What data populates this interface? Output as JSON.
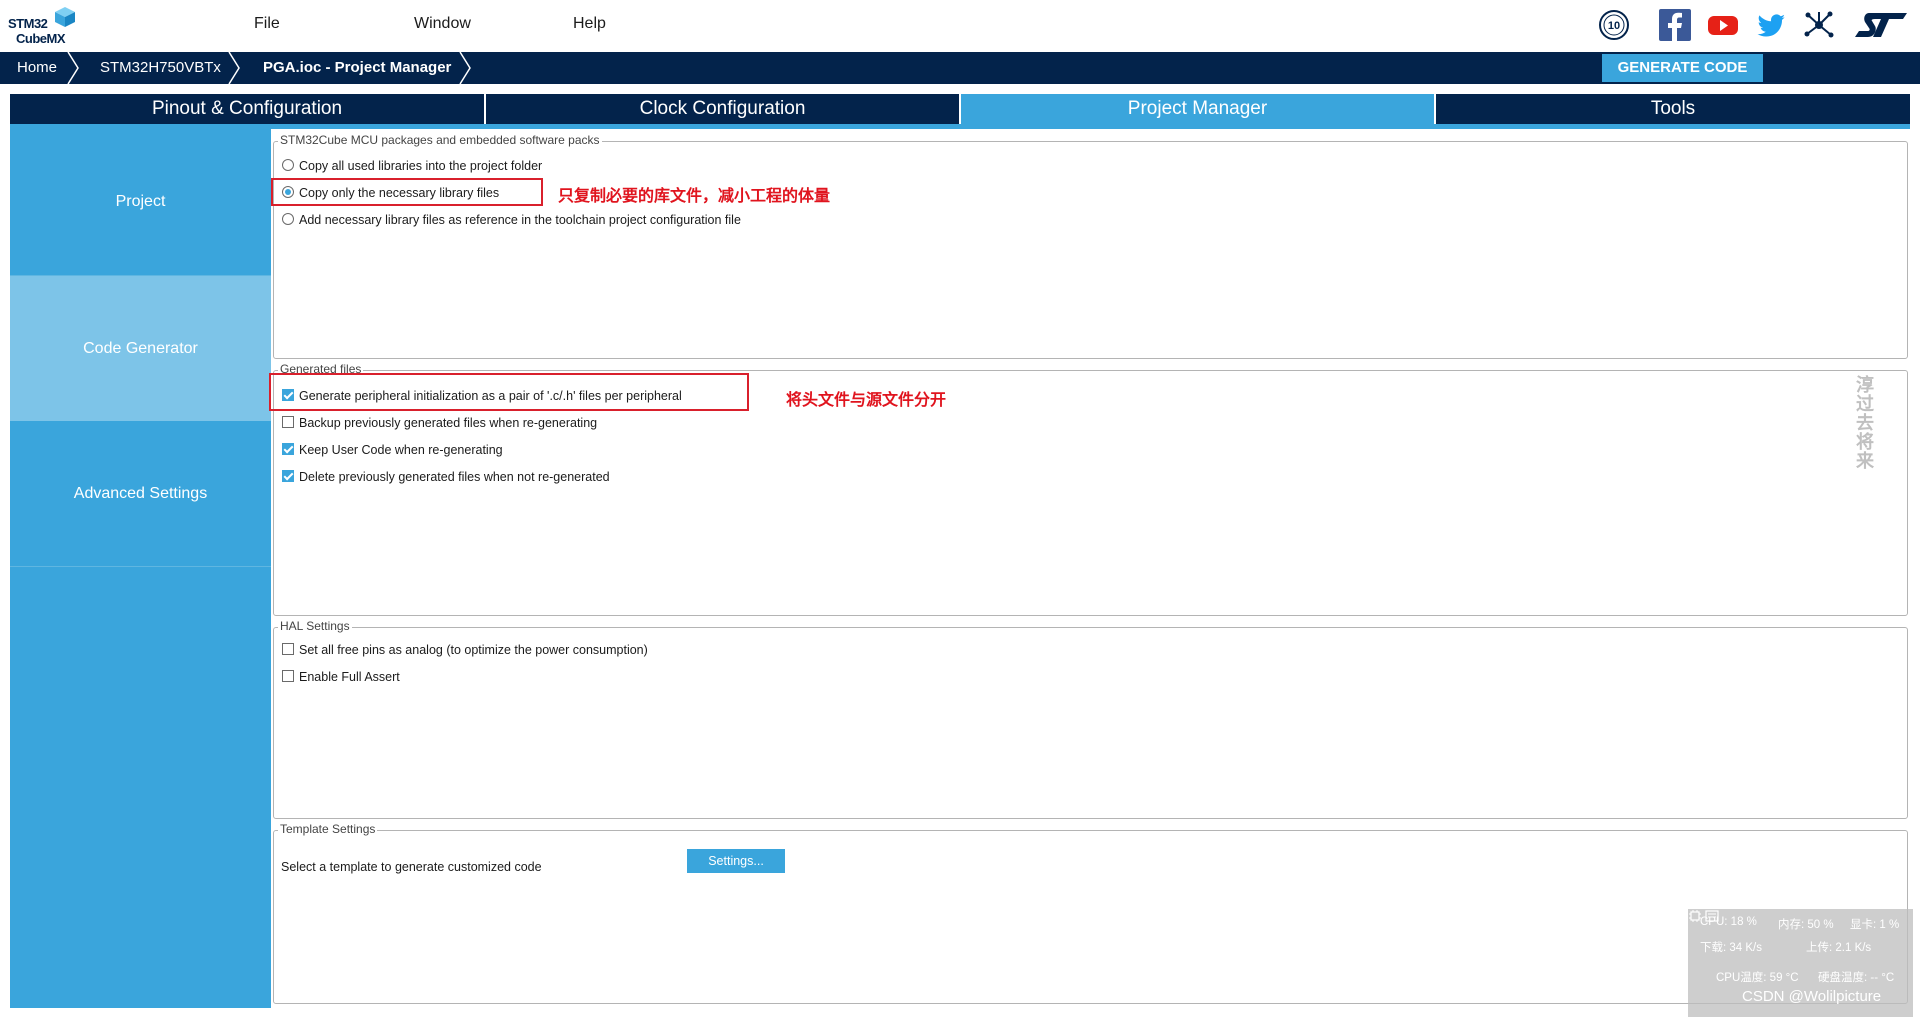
{
  "app": {
    "logo_line1": "STM32",
    "logo_line2": "CubeMX",
    "menu": [
      "File",
      "Window",
      "Help"
    ],
    "social_icons": [
      "anniversary-10-icon",
      "facebook-icon",
      "youtube-icon",
      "twitter-icon",
      "network-share-icon",
      "st-logo-icon"
    ],
    "anniversary_label": "10"
  },
  "breadcrumb": {
    "home": "Home",
    "mcu": "STM32H750VBTx",
    "project": "PGA.ioc - Project Manager"
  },
  "toolbar": {
    "generate_label": "GENERATE CODE"
  },
  "tabs": [
    {
      "label": "Pinout & Configuration",
      "active": false
    },
    {
      "label": "Clock Configuration",
      "active": false
    },
    {
      "label": "Project Manager",
      "active": true
    },
    {
      "label": "Tools",
      "active": false
    }
  ],
  "sidebar": {
    "items": [
      {
        "label": "Project",
        "active": false
      },
      {
        "label": "Code Generator",
        "active": true
      },
      {
        "label": "Advanced Settings",
        "active": false
      }
    ]
  },
  "packages": {
    "legend": "STM32Cube MCU packages and embedded software packs",
    "options": [
      {
        "label": "Copy all used libraries into the project folder",
        "selected": false
      },
      {
        "label": "Copy only the necessary library files",
        "selected": true
      },
      {
        "label": "Add necessary library files as reference in the toolchain project configuration file",
        "selected": false
      }
    ],
    "annotation": "只复制必要的库文件，减小工程的体量"
  },
  "generated": {
    "legend": "Generated files",
    "options": [
      {
        "label": "Generate peripheral initialization as a pair of '.c/.h' files per peripheral",
        "checked": true
      },
      {
        "label": "Backup previously generated files when re-generating",
        "checked": false
      },
      {
        "label": "Keep User Code when re-generating",
        "checked": true
      },
      {
        "label": "Delete previously generated files when not re-generated",
        "checked": true
      }
    ],
    "annotation": "将头文件与源文件分开"
  },
  "hal": {
    "legend": "HAL Settings",
    "options": [
      {
        "label": "Set all free pins as analog (to optimize the power consumption)",
        "checked": false
      },
      {
        "label": "Enable Full Assert",
        "checked": false
      }
    ]
  },
  "template": {
    "legend": "Template Settings",
    "text": "Select a template to generate customized code",
    "button": "Settings..."
  },
  "watermark_side": "淳过去将来",
  "system_monitor": {
    "cpu": "CPU: 18 %",
    "mem": "内存: 50 %",
    "gpu": "显卡: 1 %",
    "down": "下载: 34 K/s",
    "up": "上传: 2.1 K/s",
    "cpu_temp": "CPU温度: 59 °C",
    "disk_temp": "硬盘温度: -- °C"
  },
  "csdn_watermark": "CSDN @Wolilpicture"
}
